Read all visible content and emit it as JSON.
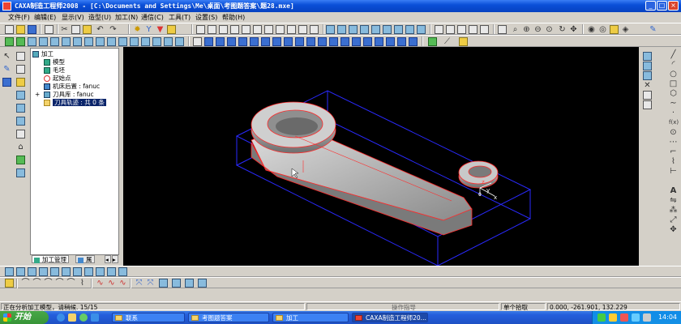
{
  "window": {
    "title": "CAXA制造工程师2008 - [C:\\Documents and Settings\\Me\\桌面\\考图题答案\\题28.mxe]"
  },
  "window_controls": {
    "minimize": "_",
    "maximize": "□",
    "close": "×"
  },
  "menu": [
    "文件(F)",
    "编辑(E)",
    "显示(V)",
    "造型(U)",
    "加工(N)",
    "通信(C)",
    "工具(T)",
    "设置(S)",
    "帮助(H)"
  ],
  "tree": {
    "root": "加工",
    "items": [
      {
        "label": "模型",
        "icon": "model-icon"
      },
      {
        "label": "毛坯",
        "icon": "blank-icon"
      },
      {
        "label": "起始点",
        "icon": "start-point-icon"
      },
      {
        "label": "机床后置 : fanuc",
        "icon": "machine-post-icon"
      },
      {
        "label": "刀具库 : fanuc",
        "icon": "tool-library-icon"
      },
      {
        "label": "刀具轨迹 : 共 0 条",
        "icon": "toolpath-folder-icon",
        "selected": true
      }
    ],
    "expand_marker": "+"
  },
  "panel_tabs": [
    "加工管理",
    "属"
  ],
  "viewport": {
    "axis_labels": {
      "y": "y",
      "z": "z",
      "x": "x",
      "origin": "0"
    }
  },
  "statusbar": {
    "message": "正在分析加工模型，请稍候. 15/15",
    "hint": "操作指导",
    "mode": "单个拾取",
    "coords": "0.000, -261.901, 132.229"
  },
  "taskbar": {
    "start": "开始",
    "tasks": [
      {
        "label": "联系",
        "active": false
      },
      {
        "label": "考图题答案",
        "active": false
      },
      {
        "label": "加工",
        "active": false
      },
      {
        "label": "CAXA制造工程师20...",
        "active": true
      }
    ],
    "clock": "14:04"
  },
  "colors": {
    "titlebar": "#0a4fd8",
    "viewport_bg": "#000000",
    "bounding_box": "#2a2aff",
    "model_edges": "#ff2a2a",
    "selection": "#0a246a"
  }
}
